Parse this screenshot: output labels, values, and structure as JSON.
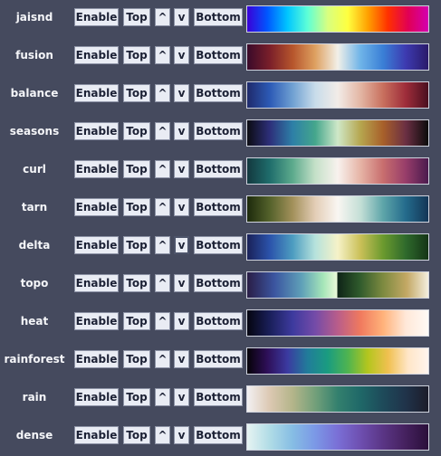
{
  "buttons": {
    "enable": "Enable",
    "top": "Top",
    "up": "^",
    "down": "v",
    "bottom": "Bottom"
  },
  "colormaps": [
    {
      "name": "jaisnd",
      "colors": [
        "#3a00d8",
        "#0057ff",
        "#00c6ff",
        "#5effd7",
        "#d8ff80",
        "#ffff3f",
        "#ffa000",
        "#ff3000",
        "#e10055",
        "#d300b0"
      ]
    },
    {
      "name": "fusion",
      "colors": [
        "#3a0a2a",
        "#7a1f2a",
        "#b6552c",
        "#dea060",
        "#f2f0e8",
        "#6fb4e8",
        "#3a7fd6",
        "#3d3ab0",
        "#2a1a6a"
      ]
    },
    {
      "name": "balance",
      "colors": [
        "#1f2a6b",
        "#2c5ab6",
        "#6fa0d2",
        "#c8dcea",
        "#f2ece8",
        "#e3b6a4",
        "#c8705e",
        "#9e2d3a",
        "#4a0f1f"
      ]
    },
    {
      "name": "seasons",
      "colors": [
        "#0c0c12",
        "#2d2f7a",
        "#2d7fa7",
        "#44a68c",
        "#cfe8c8",
        "#b6a64f",
        "#a8602a",
        "#6b2f43",
        "#0b0b0b"
      ]
    },
    {
      "name": "curl",
      "colors": [
        "#13383f",
        "#1f6d6c",
        "#5caa8c",
        "#c4e0c8",
        "#f8f2ee",
        "#e6b4a6",
        "#c86e6e",
        "#973d6a",
        "#4a1a4e"
      ]
    },
    {
      "name": "tarn",
      "colors": [
        "#1d2a0c",
        "#54622b",
        "#a2905a",
        "#e3cdb6",
        "#f9f6f2",
        "#c4dfd6",
        "#5ea5a9",
        "#246b8c",
        "#133556"
      ]
    },
    {
      "name": "delta",
      "colors": [
        "#1a2158",
        "#2b53ab",
        "#4c9cc0",
        "#b6e2dc",
        "#f6f2c8",
        "#cac058",
        "#6b9a2e",
        "#2f6a2c",
        "#143416"
      ]
    },
    {
      "name": "topo",
      "colors": [
        "#2a1d46",
        "#3b55a0",
        "#5fa0b8",
        "#a6e6b8",
        "#eaf8d8",
        "#0f2417",
        "#2f5a2c",
        "#7d8a40",
        "#c3a864",
        "#f3eede"
      ],
      "stops": [
        0,
        17,
        35,
        62,
        49.5,
        50,
        62,
        75,
        88,
        100
      ]
    },
    {
      "name": "heat",
      "colors": [
        "#050510",
        "#1a1f5a",
        "#3d3a9e",
        "#744ba8",
        "#b95d8a",
        "#f07a5e",
        "#ffb27a",
        "#ffe8d8",
        "#fffaf6"
      ]
    },
    {
      "name": "rainforest",
      "colors": [
        "#060208",
        "#2e0f58",
        "#3b3aa0",
        "#217c9a",
        "#1a9c80",
        "#4fb450",
        "#b4c61e",
        "#f0c050",
        "#ffe6c8",
        "#fff4ee"
      ]
    },
    {
      "name": "rain",
      "colors": [
        "#f2f0f2",
        "#dcc8b2",
        "#b4b58a",
        "#73a07a",
        "#33806e",
        "#1f6868",
        "#1e4a5a",
        "#20334a",
        "#1c1c2a"
      ]
    },
    {
      "name": "dense",
      "colors": [
        "#e6f3f2",
        "#b0dce6",
        "#86bde4",
        "#7b98e6",
        "#7a6fd6",
        "#6e4fb0",
        "#5a3585",
        "#45215e",
        "#2a0f3a"
      ]
    }
  ]
}
